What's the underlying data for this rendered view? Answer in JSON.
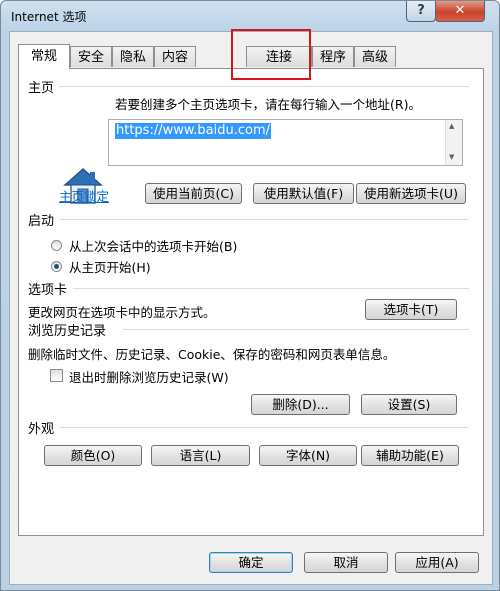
{
  "window": {
    "title": "Internet 选项",
    "help": "?",
    "close": "✕"
  },
  "tabs": [
    "常规",
    "安全",
    "隐私",
    "内容",
    "连接",
    "程序",
    "高级"
  ],
  "homepage": {
    "section_title": "主页",
    "description": "若要创建多个主页选项卡，请在每行输入一个地址(R)。",
    "url": "https://www.baidu.com/",
    "lock_link": "主页锁定",
    "use_current": "使用当前页(C)",
    "use_default": "使用默认值(F)",
    "use_new_tab": "使用新选项卡(U)"
  },
  "startup": {
    "section_title": "启动",
    "option_previous": "从上次会话中的选项卡开始(B)",
    "option_homepage": "从主页开始(H)",
    "selected": "option_homepage"
  },
  "tabs_section": {
    "section_title": "选项卡",
    "description": "更改网页在选项卡中的显示方式。",
    "button": "选项卡(T)"
  },
  "history": {
    "section_title": "浏览历史记录",
    "description": "删除临时文件、历史记录、Cookie、保存的密码和网页表单信息。",
    "checkbox_label": "退出时删除浏览历史记录(W)",
    "checkbox_checked": false,
    "delete_button": "删除(D)...",
    "settings_button": "设置(S)"
  },
  "appearance": {
    "section_title": "外观",
    "colors": "颜色(O)",
    "languages": "语言(L)",
    "fonts": "字体(N)",
    "accessibility": "辅助功能(E)"
  },
  "footer": {
    "ok": "确定",
    "cancel": "取消",
    "apply": "应用(A)"
  },
  "colors": {
    "highlight": "#d9141b",
    "selection": "#3399ff",
    "link": "#0066cc"
  }
}
